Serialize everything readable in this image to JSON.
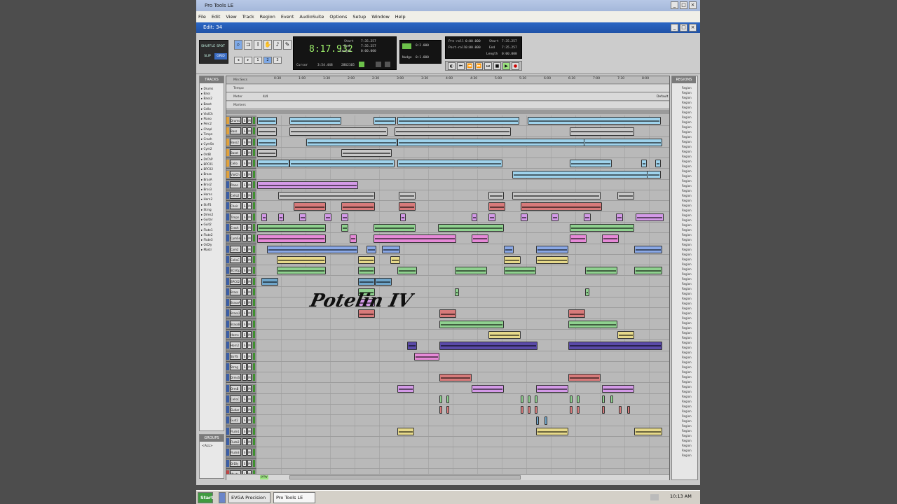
{
  "window": {
    "title": "Pro Tools LE",
    "controls": [
      "_",
      "□",
      "×"
    ]
  },
  "menu": [
    "File",
    "Edit",
    "View",
    "Track",
    "Region",
    "Event",
    "AudioSuite",
    "Options",
    "Setup",
    "Window",
    "Help"
  ],
  "edit_window": {
    "title": "Edit: 34"
  },
  "toolbar": {
    "modes": [
      "SHUFFLE",
      "SPOT",
      "SLIP",
      "GRID"
    ],
    "main_counter": "8:17.932",
    "start_label": "Start",
    "start_value": "7:35.257",
    "end_label": "End",
    "end_value": "7:35.257",
    "length_label": "Length",
    "length_value": "0:00.000",
    "cursor_label": "Cursor",
    "cursor_value": "3:54.448",
    "cursor_samples": "2862105",
    "grid_value": "0:2.000",
    "nudge_label": "Nudge",
    "nudge_value": "0:1.000",
    "preroll_label": "Pre-roll",
    "preroll_value": "0:00.000",
    "postroll_label": "Post-roll",
    "postroll_value": "0:00.000",
    "pp_start": "7:35.257",
    "pp_end": "7:35.257",
    "pp_length": "0:00.000"
  },
  "panels": {
    "tracks_header": "TRACKS",
    "groups_header": "GROUPS",
    "regions_header": "REGIONS",
    "groups_item": "<ALL>"
  },
  "ruler": {
    "rows": [
      "Min:Secs",
      "Tempo",
      "Meter",
      "Markers"
    ],
    "ticks": [
      "0:30",
      "1:00",
      "1:30",
      "2:00",
      "2:30",
      "3:00",
      "3:30",
      "4:00",
      "4:30",
      "5:00",
      "5:30",
      "6:00",
      "6:30",
      "7:00",
      "7:30",
      "8:00"
    ],
    "meter_start": "4/4",
    "meter_end": "Default"
  },
  "tracks": [
    "Drums",
    "Bass",
    "Bass2",
    "Basst",
    "Cello",
    "ViolCh",
    "Piano",
    "Cello2",
    "Choir",
    "Timpn",
    "Crash",
    "CymSn",
    "Cym2",
    "CelloC",
    "BChOp",
    "BPC02",
    "Brass",
    "BrassA",
    "Brass2",
    "BrassB",
    "Horns",
    "Horn2",
    "StrFS",
    "Strng",
    "DrmsS",
    "OrmB",
    "CelloC",
    "Guitar",
    "Guit2",
    "Flute1",
    "Flute2",
    "Flute3",
    "OrDly",
    "Mastr"
  ],
  "tracks_list": [
    "Drums",
    "Bass",
    "Bass2",
    "Basst",
    "Cello",
    "ViolCh",
    "Piano",
    "Perc2",
    "Chopl",
    "Timpn",
    "Crash",
    "CymSn",
    "Cym2",
    "OrdB",
    "DrChP",
    "BPC01",
    "BPC02",
    "Brass",
    "BrasA",
    "Brss2",
    "Brss3",
    "Horns",
    "Horn2",
    "StrFS",
    "Strng",
    "Drms2",
    "Guitar",
    "Guit2",
    "Flute1",
    "Flute2",
    "Flute3",
    "OrDly",
    "Mastr"
  ],
  "watermark": "Potelin IV",
  "regions": [
    "Region"
  ],
  "status": {
    "play": "play"
  },
  "taskbar": {
    "start": "Start",
    "items": [
      "EVGA Precision",
      "Pro Tools LE"
    ],
    "clock": "10:13 AM"
  },
  "colors": {
    "audio": "#9fd3ec",
    "violet": "#d49ae8",
    "red": "#d77a7a",
    "green": "#8fd18f",
    "magenta": "#e68ad8",
    "yellow": "#e6d98a",
    "blue": "#8aa8e6",
    "purple": "#5a4aa8",
    "teal": "#6fa5c9",
    "grey": "#c8c8c8"
  }
}
